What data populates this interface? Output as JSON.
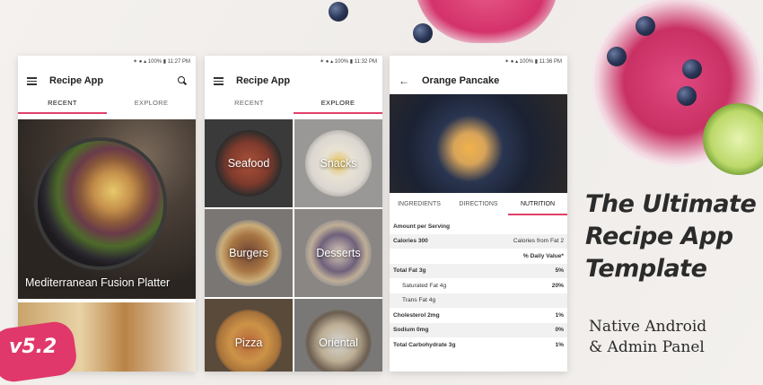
{
  "decor": {
    "accent": "#e0406a"
  },
  "phone1": {
    "status": "✶ ● ▴ 100% ▮ 11:27 PM",
    "title": "Recipe App",
    "tabs": [
      "RECENT",
      "EXPLORE"
    ],
    "featured": {
      "label": "Mediterranean Fusion Platter"
    }
  },
  "phone2": {
    "status": "✶ ● ▴ 100% ▮ 11:32 PM",
    "title": "Recipe App",
    "tabs": [
      "RECENT",
      "EXPLORE"
    ],
    "categories": [
      "Seafood",
      "Snacks",
      "Burgers",
      "Desserts",
      "Pizza",
      "Oriental"
    ]
  },
  "phone3": {
    "status": "✶ ● ▴ 100% ▮ 11:36 PM",
    "title": "Orange Pancake",
    "tabs": [
      "INGREDIENTS",
      "DIRECTIONS",
      "NUTRITION"
    ],
    "nutrition": [
      {
        "label": "Amount per Serving",
        "value": ""
      },
      {
        "label": "Calories 300",
        "value": "Calories from Fat 2"
      },
      {
        "label": "",
        "value": "% Daily Value*"
      },
      {
        "label": "Total Fat 3g",
        "value": "5%"
      },
      {
        "label": "Saturated Fat 4g",
        "value": "20%"
      },
      {
        "label": "Trans Fat 4g",
        "value": ""
      },
      {
        "label": "Cholesterol 2mg",
        "value": "1%"
      },
      {
        "label": "Sodium 0mg",
        "value": "0%"
      },
      {
        "label": "Total Carbohydrate 3g",
        "value": "1%"
      }
    ]
  },
  "promo": {
    "headline": [
      "The Ultimate",
      "Recipe App",
      "Template"
    ],
    "subline": [
      "Native Android",
      "& Admin Panel"
    ],
    "version_badge": "v5.2"
  }
}
